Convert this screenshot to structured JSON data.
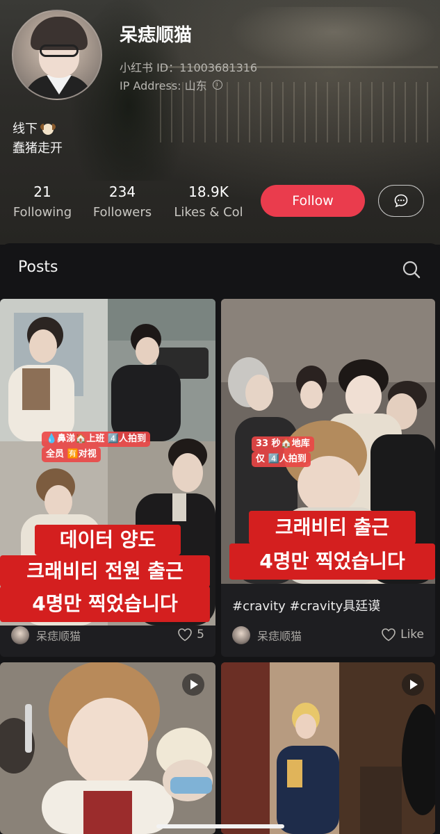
{
  "profile": {
    "nickname": "呆痣顺猫",
    "red_id": "小红书 ID：11003681316",
    "ip_address": "IP Address: 山东",
    "bio_line1": "线下",
    "bio_line2": "蠢猪走开"
  },
  "stats": [
    {
      "value": "21",
      "label": "Following"
    },
    {
      "value": "234",
      "label": "Followers"
    },
    {
      "value": "18.9K",
      "label": "Likes & Col"
    }
  ],
  "actions": {
    "follow_label": "Follow",
    "message_icon": "chat-bubble-icon"
  },
  "posts_section": {
    "tab_label": "Posts",
    "search_icon": "search-icon"
  },
  "posts": [
    {
      "caption_small_1": "💧鼻涕🏠上班 4️⃣人拍到",
      "caption_small_2": "全员 🈶对视",
      "caption_big_1": "데이터 양도",
      "caption_big_2": "크래비티 전원 출근",
      "caption_big_3": "4명만 찍었습니다",
      "author": "呆痣顺猫",
      "likes": "5"
    },
    {
      "caption_small_1": "33 秒🏠地库",
      "caption_small_2": "仅 4️⃣人拍到",
      "caption_big_1": "크래비티 출근",
      "caption_big_2": "4명만 찍었습니다",
      "title": "#cravity #cravity具廷谟",
      "author": "呆痣顺猫",
      "likes": "Like"
    },
    {
      "type": "video"
    },
    {
      "type": "video"
    }
  ],
  "colors": {
    "accent": "#ea3c4d",
    "caption_red": "#d41f1f",
    "panel_bg": "#141416",
    "card_bg": "#1e1e21"
  }
}
